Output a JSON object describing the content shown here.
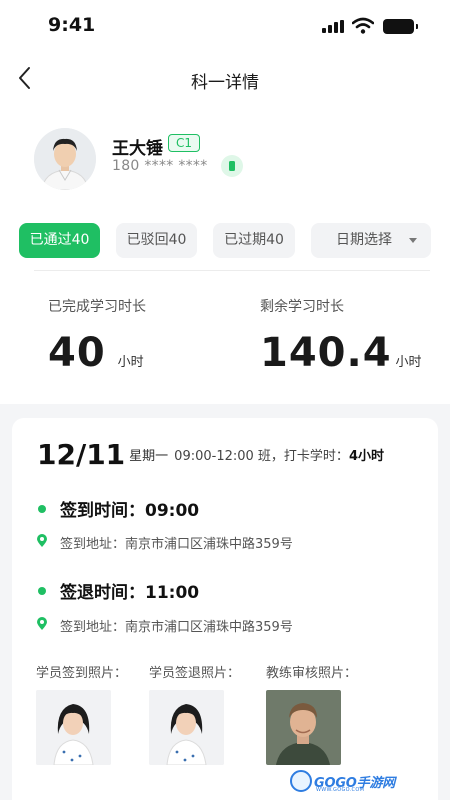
{
  "status_bar": {
    "time": "9:41"
  },
  "nav": {
    "title": "科一详情"
  },
  "profile": {
    "name": "王大锤",
    "license": "C1",
    "phone": "180 **** ****"
  },
  "filters": {
    "passed": "已通过40",
    "rejected": "已驳回40",
    "expired": "已过期40",
    "date_picker": "日期选择"
  },
  "stats": {
    "completed_label": "已完成学习时长",
    "completed_value": "40",
    "completed_unit": "小时",
    "remaining_label": "剩余学习时长",
    "remaining_value": "140.4",
    "remaining_unit": "小时"
  },
  "session": {
    "date": "12/11",
    "weekday": "星期一",
    "detail": "09:00-12:00 班，打卡学时：",
    "hours": "4小时",
    "check_in_time": "签到时间：09:00",
    "check_in_address": "签到地址：南京市浦口区浦珠中路359号",
    "check_out_time": "签退时间：11:00",
    "check_out_address": "签到地址：南京市浦口区浦珠中路359号"
  },
  "photos": {
    "student_check_in_label": "学员签到照片：",
    "student_check_out_label": "学员签退照片：",
    "coach_review_label": "教练审核照片："
  },
  "watermark": {
    "brand": "GOGO手游网",
    "url": "WWW.GOGO.COM"
  },
  "colors": {
    "accent": "#1fbf63",
    "chip_bg": "#f2f3f5",
    "background_gray": "#f4f5f7",
    "watermark": "#2f7de1"
  }
}
